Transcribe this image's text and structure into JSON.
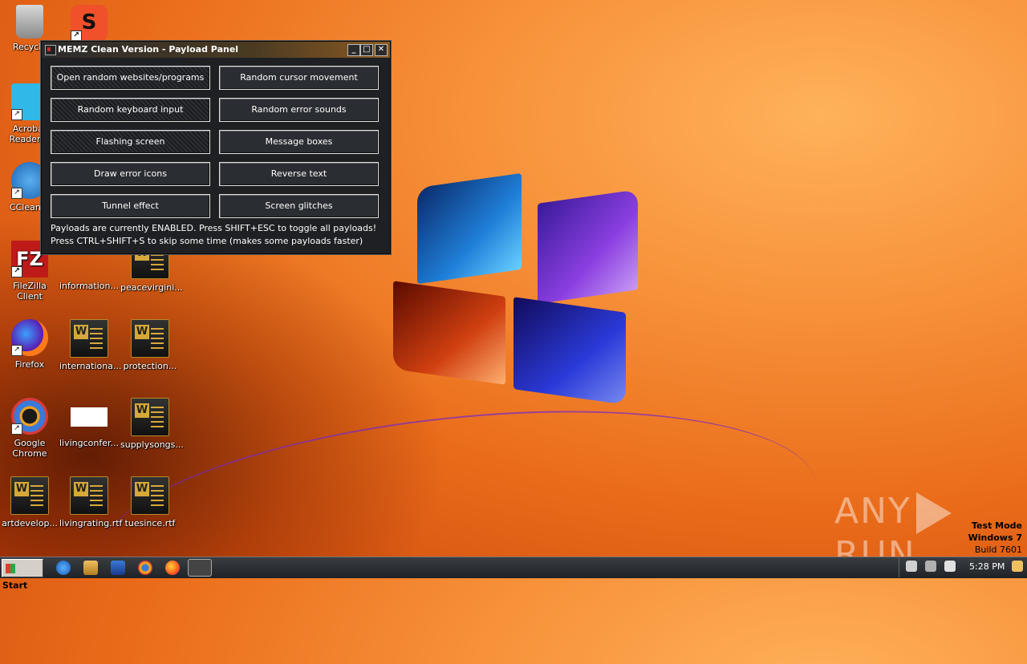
{
  "desktop": {
    "icons": [
      {
        "label": "Recycle",
        "icon": "recycle-bin-icon"
      },
      {
        "label": "",
        "icon": "smallpdf-icon"
      },
      {
        "label": "Acrobat Reader D",
        "icon": "acrobat-reader-icon"
      },
      {
        "label": "CCleaner",
        "icon": "ccleaner-icon"
      },
      {
        "label": "FileZilla Client",
        "icon": "filezilla-icon"
      },
      {
        "label": "information...",
        "icon": "word-doc-icon"
      },
      {
        "label": "peacevirgini...",
        "icon": "word-doc-icon"
      },
      {
        "label": "Firefox",
        "icon": "firefox-icon"
      },
      {
        "label": "internationa...",
        "icon": "word-doc-icon"
      },
      {
        "label": "protection...",
        "icon": "word-doc-icon"
      },
      {
        "label": "Google Chrome",
        "icon": "chrome-icon"
      },
      {
        "label": "livingconfer...",
        "icon": "document-thumbnail-icon"
      },
      {
        "label": "supplysongs...",
        "icon": "word-doc-icon"
      },
      {
        "label": "artdevelop...",
        "icon": "word-doc-icon"
      },
      {
        "label": "livingrating.rtf",
        "icon": "word-doc-icon"
      },
      {
        "label": "tuesince.rtf",
        "icon": "word-doc-icon"
      }
    ]
  },
  "window": {
    "title": "MEMZ Clean Version - Payload Panel",
    "buttons": [
      {
        "label": "Open random websites/programs",
        "active": true
      },
      {
        "label": "Random cursor movement",
        "active": false
      },
      {
        "label": "Random keyboard input",
        "active": true
      },
      {
        "label": "Random error sounds",
        "active": false
      },
      {
        "label": "Flashing screen",
        "active": true
      },
      {
        "label": "Message boxes",
        "active": false
      },
      {
        "label": "Draw error icons",
        "active": false
      },
      {
        "label": "Reverse text",
        "active": false
      },
      {
        "label": "Tunnel effect",
        "active": false
      },
      {
        "label": "Screen glitches",
        "active": false
      }
    ],
    "status_line1": "Payloads are currently ENABLED. Press SHIFT+ESC to toggle all payloads!",
    "status_line2": "Press CTRL+SHIFT+S to skip some time (makes some payloads faster)"
  },
  "watermark": {
    "text_left": "ANY",
    "text_right": "RUN",
    "test_mode": "Test Mode",
    "os": "Windows 7",
    "build": "Build 7601"
  },
  "taskbar": {
    "start_label": "Start",
    "pinned": [
      "ie-icon",
      "explorer-icon",
      "media-player-icon",
      "chrome-icon",
      "firefox-icon",
      "memz-app-icon"
    ],
    "clock": "5:28 PM",
    "tray_icons": [
      "speaker-icon",
      "network-icon",
      "action-center-flag-icon",
      "show-desktop-icon"
    ]
  }
}
